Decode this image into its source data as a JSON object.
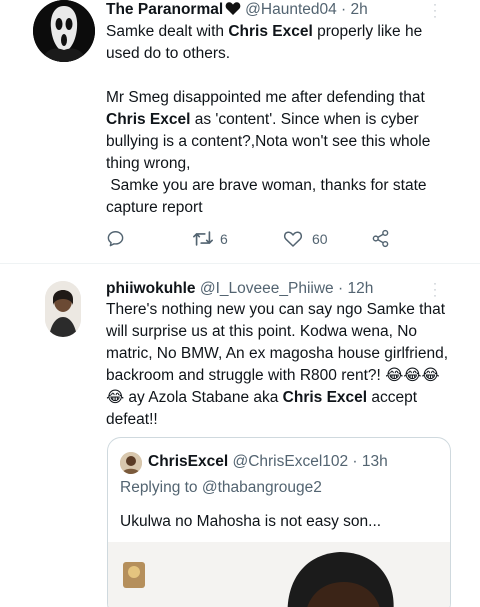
{
  "tweet1": {
    "display_name": "The Paranormal",
    "handle": "@Haunted04",
    "sep": " · ",
    "time": "2h",
    "avatar_icon": "ghostface-avatar",
    "heart_icon": "black-heart-icon",
    "paragraphs": [
      [
        {
          "t": "Samke dealt with "
        },
        {
          "t": "Chris Excel",
          "b": true
        },
        {
          "t": " properly like he used do to others."
        }
      ],
      [
        {
          "t": "Mr Smeg disappointed me after defending that "
        },
        {
          "t": "Chris Excel",
          "b": true
        },
        {
          "t": " as 'content'. Since when is cyber bullying is a content?,Nota won't see this whole thing wrong,\n Samke you are brave woman, thanks for state capture report"
        }
      ]
    ],
    "retweets": "6",
    "likes": "60"
  },
  "tweet2": {
    "display_name": "phiiwokuhle",
    "handle": "@I_Loveee_Phiiwe",
    "sep": " · ",
    "time": "12h",
    "paragraphs": [
      [
        {
          "t": "There's nothing new you can say ngo Samke that will surprise us at this point. Kodwa wena, No matric, No BMW, An ex magosha house girlfriend, backroom and struggle with R800 rent?! 😂😂😂😂 ay Azola Stabane aka "
        },
        {
          "t": "Chris Excel",
          "b": true
        },
        {
          "t": " accept defeat!!"
        }
      ]
    ]
  },
  "quote": {
    "display_name": "ChrisExcel",
    "handle": "@ChrisExcel102",
    "sep": " · ",
    "time": "13h",
    "replying_prefix": "Replying to ",
    "replying_handle": "@thabangrouge2",
    "text": "Ukulwa no Mahosha is not easy son..."
  },
  "colors": {
    "text": "#0f1419",
    "secondary": "#536471",
    "border": "#cfd9de"
  }
}
